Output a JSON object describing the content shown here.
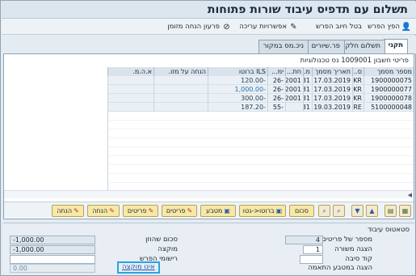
{
  "title": "תשלום עם תדפיס עיבוד שורות פתוחות",
  "toolbar": {
    "items": [
      {
        "label": "הפץ הפרש",
        "icon": "person-icon"
      },
      {
        "label": "בטל חיוב הפרש",
        "icon": "none"
      },
      {
        "label": "אפשרויות עריכה",
        "icon": "pencil-icon"
      },
      {
        "label": "פרעון הנחה מזומן",
        "icon": "cancel-icon"
      }
    ]
  },
  "tabs": [
    "תקני",
    "תשלום חלקי",
    "פר.שיורים",
    "ניכ.מס במקור"
  ],
  "panel": {
    "header": "פריטי חשבון 1009001 נס טכנולוגיות"
  },
  "grid": {
    "columns": [
      "מספר מסמך",
      "ס..",
      "תאריך מסמך",
      "מ..",
      "חת...",
      "ימ...",
      "ILS ברוטו",
      "הנחה על מזו.",
      "א.ה.מ."
    ],
    "rows": [
      {
        "doc": "1900000075",
        "type": "KR",
        "date": "17.03.2019",
        "m": "31",
        "period": "2001",
        "days": "-26",
        "gross": "-120.00",
        "disc": "",
        "aem": ""
      },
      {
        "doc": "1900000077",
        "type": "KR",
        "date": "17.03.2019",
        "m": "31",
        "period": "2001",
        "days": "-26",
        "gross": "-1,000.00",
        "disc": "",
        "aem": ""
      },
      {
        "doc": "1900000078",
        "type": "KR",
        "date": "17.03.2019",
        "m": "31",
        "period": "2001",
        "days": "-26",
        "gross": "-300.00",
        "disc": "",
        "aem": ""
      },
      {
        "doc": "5100000048",
        "type": "RE",
        "date": "19.03.2019",
        "m": "31",
        "period": "",
        "days": "-55",
        "gross": "-187.20",
        "disc": "",
        "aem": ""
      }
    ]
  },
  "buttons": {
    "sum": "סכום",
    "gross_net": "ברוטו<-נטו",
    "currency": "מטבע",
    "items1": "פריטים",
    "items2": "פריטים",
    "discount1": "הנחה",
    "discount2": "הנחה"
  },
  "status": {
    "title": "סטאטוס עיבוד",
    "items_count_label": "מספר של פריטים",
    "items_count": "4",
    "display_from_label": "הצגה משורה",
    "display_from": "1",
    "reason_code_label": "קוד סיבה",
    "reason_code": "",
    "display_currency_label": "הצגה במטבע התאמה",
    "amount_entered_label": "סכום שהוזן",
    "amount_entered": "-1,000.00",
    "assigned_label": "מוקצה",
    "assigned": "-1,000.00",
    "diff_postings_label": "רישומי הפרש",
    "diff_postings": "",
    "not_assigned_label": "אינו מוקצה",
    "not_assigned": "0.00"
  }
}
